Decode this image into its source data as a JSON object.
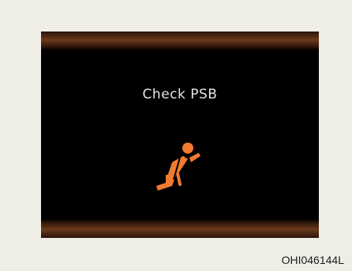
{
  "display": {
    "message": "Check PSB",
    "icon": "seatbelt-warning-icon",
    "icon_color": "#f07a30",
    "background_color": "#000000"
  },
  "figure": {
    "code": "OHI046144L"
  }
}
